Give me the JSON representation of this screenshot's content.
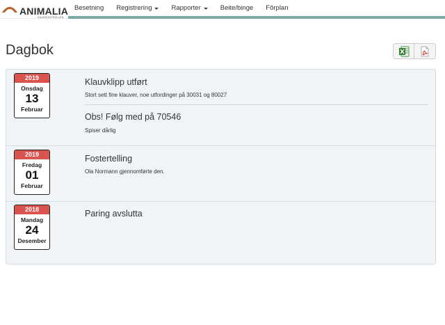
{
  "brand": {
    "name": "ANIMALIA",
    "subtitle": "SAUEKONTROLLEN",
    "logo_color": "#b5652b"
  },
  "nav": {
    "items": [
      {
        "label": "Besetning",
        "dropdown": false
      },
      {
        "label": "Registrering",
        "dropdown": true
      },
      {
        "label": "Rapporter",
        "dropdown": true
      },
      {
        "label": "Beite/binge",
        "dropdown": false
      },
      {
        "label": "Fôrplan",
        "dropdown": false
      }
    ],
    "accent_color": "#7aa7a8"
  },
  "page": {
    "title": "Dagbok"
  },
  "export": {
    "excel_icon": "excel-icon",
    "pdf_icon": "pdf-icon"
  },
  "entries": [
    {
      "date": {
        "year": "2019",
        "weekday": "Onsdag",
        "day": "13",
        "month": "Februar"
      },
      "notes": [
        {
          "title": "Klauvklipp utført",
          "description": "Stort sett fine klauver, noe utfordinger på 30031 og 80027"
        },
        {
          "title": "Obs! Følg med på 70546",
          "description": "Spiser dårlig"
        }
      ]
    },
    {
      "date": {
        "year": "2019",
        "weekday": "Fredag",
        "day": "01",
        "month": "Februar"
      },
      "notes": [
        {
          "title": "Fostertelling",
          "description": "Ola Normann gjennomførte den."
        }
      ]
    },
    {
      "date": {
        "year": "2018",
        "weekday": "Mandag",
        "day": "24",
        "month": "Desember"
      },
      "notes": [
        {
          "title": "Paring avslutta",
          "description": ""
        }
      ]
    }
  ],
  "colors": {
    "calendar_header": "#d9534f",
    "panel_background": "#f0f4f7"
  }
}
